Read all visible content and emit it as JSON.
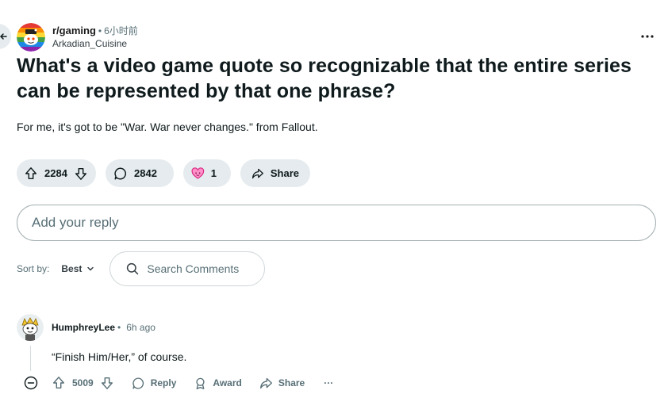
{
  "post": {
    "subreddit": "r/gaming",
    "separator": "•",
    "time": "6小时前",
    "author": "Arkadian_Cuisine",
    "title": "What's a video game quote so recognizable that the entire series can be represented by that one phrase?",
    "body": "For me, it's got to be \"War. War never changes.\" from Fallout.",
    "upvotes": "2284",
    "comments": "2842",
    "awards": "1",
    "share_label": "Share"
  },
  "reply": {
    "placeholder": "Add your reply"
  },
  "sort": {
    "label": "Sort by:",
    "value": "Best",
    "search_placeholder": "Search Comments"
  },
  "comment": {
    "author": "HumphreyLee",
    "separator": "•",
    "time": "6h ago",
    "body": "“Finish Him/Her,” of course.",
    "upvotes": "5009",
    "reply_label": "Reply",
    "award_label": "Award",
    "share_label": "Share",
    "more": "···"
  },
  "colors": {
    "pill_bg": "#e5ebee",
    "meta_text": "#576f76",
    "title_text": "#0f1a1c",
    "award_pink": "#ff4fa3"
  },
  "icons": [
    "back-arrow-icon",
    "subreddit-avatar-icon",
    "overflow-menu-icon",
    "upvote-icon",
    "downvote-icon",
    "comment-icon",
    "award-icon",
    "share-icon",
    "chevron-down-icon",
    "search-icon",
    "collapse-icon",
    "user-avatar-icon",
    "award-ribbon-icon"
  ]
}
